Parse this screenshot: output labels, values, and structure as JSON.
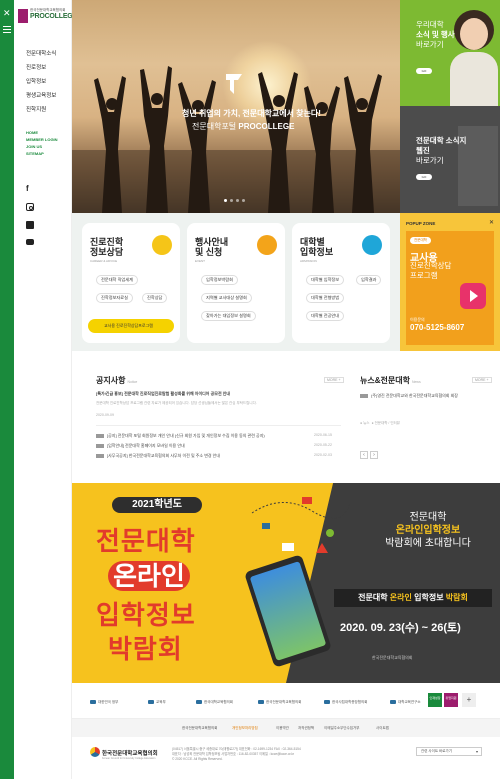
{
  "brand": {
    "small_text": "한국전문대학교육협의회",
    "logo_text": "PROCOLLEGE",
    "logo_color": "#2a6e3a"
  },
  "sidebar": {
    "menu": [
      "전문대학소식",
      "진로정보",
      "입학정보",
      "평생교육정보",
      "진학지원"
    ],
    "links": [
      "HOME",
      "MEMBER LOGIN",
      "JOIN US",
      "SITEMAP"
    ],
    "social_icons": [
      "facebook-icon",
      "instagram-icon",
      "talk-icon",
      "youtube-icon"
    ]
  },
  "hero": {
    "line1": "청년 취업",
    "line1_b": "의 가치, 전문대학교에서 찾는다!",
    "line2": "전문대학포털",
    "line2_b": " PROCOLLEGE",
    "dots": 4,
    "active_dot": 1
  },
  "promo": {
    "p1_line1": "우리대학",
    "p1_line2": "소식 및 행사",
    "p1_line3": "바로가기",
    "p2_line1": "전문대학 소식지",
    "p2_line2": "웹진",
    "p2_line3": "바로가기",
    "btn": "GO"
  },
  "cards": [
    {
      "title1": "진로진학",
      "title2": "정보상담",
      "sub": "CAREER & ADVICE",
      "color": "#f5c518",
      "items": [
        "전문대학 직업세계",
        "진학정보자료실",
        "진학상담",
        "교사용 진로진학상담프로그램"
      ]
    },
    {
      "title1": "행사안내",
      "title2": "및 신청",
      "sub": "EVENT",
      "color": "#f3a41a",
      "items": [
        "입학정보박람회",
        "지역별 교사대상 설명회",
        "찾아가는 대입정보 설명회"
      ]
    },
    {
      "title1": "대학별",
      "title2": "입학정보",
      "sub": "ADMISSION",
      "color": "#1fa6d8",
      "items": [
        "대학별 입학정보",
        "입학결과",
        "대학별 전형방법",
        "대학별 전공안내"
      ]
    }
  ],
  "popup": {
    "header": "POPUP ZONE",
    "tag": "전문대학",
    "big": "교사용",
    "sm1": "진로진학상담",
    "sm2": "프로그램",
    "phone_label": "이용문의",
    "phone": "070-5125-8607"
  },
  "notice": {
    "title": "공지사항",
    "title_en": "Notice",
    "more": "MORE +",
    "featured": "[특가/긴급 홍보] 전문대학 진로직업진로탐험 활성화를 위해 아이디어 공모전 안내",
    "featured_desc": "전문대학 진로진학상담 프로그램 관련 자료가 제공되어 있습니다. 담당 선생님들께서는 많은 관심 부탁드립니다.",
    "featured_date": "2020-09-09",
    "items": [
      {
        "text": "[공지] 전문대학 포털 회원정보 개인 안내 (신규 회원 가입 및 개인정보 수집 이용 동의 관련 공지)",
        "date": "2020-06-15"
      },
      {
        "text": "[입학안내] 전문대학 홈페이지 모바일 이용 안내",
        "date": "2020-05-22"
      },
      {
        "text": "[사무국공지] 한국전문대학교육협의회 사무처 이전 및 주소 변경 안내",
        "date": "2020-02-03"
      }
    ]
  },
  "newsroom": {
    "title": "뉴스&전문대학",
    "title_en": "News",
    "more": "MORE +",
    "headline": "(주)영진 전문대학교와 한국전문대학교육협의회 회장",
    "meta1": "● 뉴스",
    "meta2": "● 전문대학 / 인터뷰"
  },
  "banner": {
    "year": "2021학년도",
    "line1": "전문대학",
    "line2": "온라인",
    "line3": "입학정보",
    "line4": "박람회",
    "r1": "전문대학",
    "r2": "온라인입학정보",
    "r3": "박람회에 초대합니다",
    "r4a": "전문대학 ",
    "r4b": "온라인",
    "r4c": " 입학정보 ",
    "r4d": "박람회",
    "date": "2020. 09. 23(수) ~ 26(토)",
    "org": "한국전문대학교육협의회",
    "accent": "#e23b2b",
    "yellow": "#f6c21e"
  },
  "partners": {
    "logos": [
      "대한민국 정부",
      "교육부",
      "한국대학교육협의회",
      "한국전문대학교육협의회",
      "한국사립대학총장협의회",
      "대학교육연구소"
    ],
    "badge1": "인재성장",
    "badge2": "취업지원",
    "plus": "+"
  },
  "footer": {
    "links": [
      "한국전문대학교육협의회",
      "개인정보처리방침",
      "이용약관",
      "저작권정책",
      "이메일주소무단수집거부",
      "사이트맵"
    ],
    "org": "한국전문대학교육협의회",
    "org_en": "Korean Council for University College Education",
    "addr1": "(04517) 서울특별시 중구 세종대로 70(태평로2가)   대표전화 : 02-1699-1234   FAX : 02-364-5154",
    "addr2": "대표자 : 남성희 전문대학 입학정보팀   사업자번호 : 116-82-00357   이메일 : kcce@kcce.or.kr",
    "copy": "© 2020 KCCE. All Rights Reserved.",
    "select": "관련 사이트 바로가기"
  }
}
